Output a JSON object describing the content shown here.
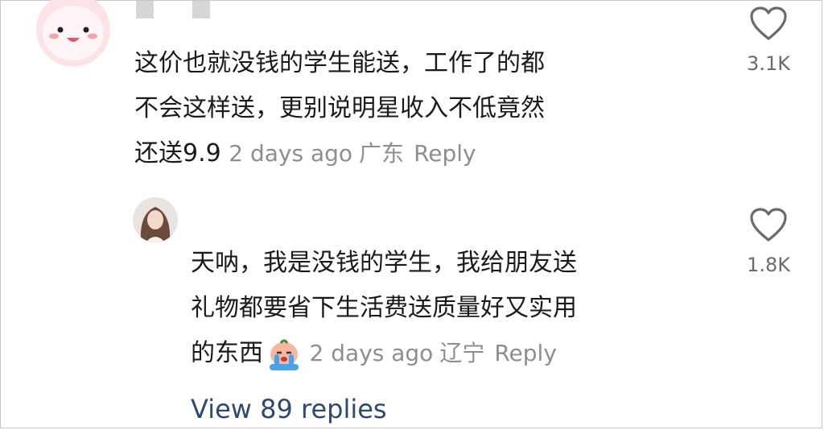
{
  "comments": [
    {
      "text_lines": [
        "这价也就没钱的学生能送，工作了的都",
        "不会这样送，更别说明星收入不低竟然",
        "还送9.9"
      ],
      "time": "2 days ago",
      "location": "广东",
      "reply_label": "Reply",
      "likes": "3.1K"
    },
    {
      "text_lines": [
        "天呐，我是没钱的学生，我给朋友送",
        "礼物都要省下生活费送质量好又实用",
        "的东西"
      ],
      "emoji": "crying-face-emoji",
      "time": "2 days ago",
      "location": "辽宁",
      "reply_label": "Reply",
      "likes": "1.8K"
    }
  ],
  "view_replies": "View 89 replies",
  "colors": {
    "meta": "#8e8e8e",
    "link": "#2d4a72",
    "avatar1": "#fbe4e6"
  }
}
